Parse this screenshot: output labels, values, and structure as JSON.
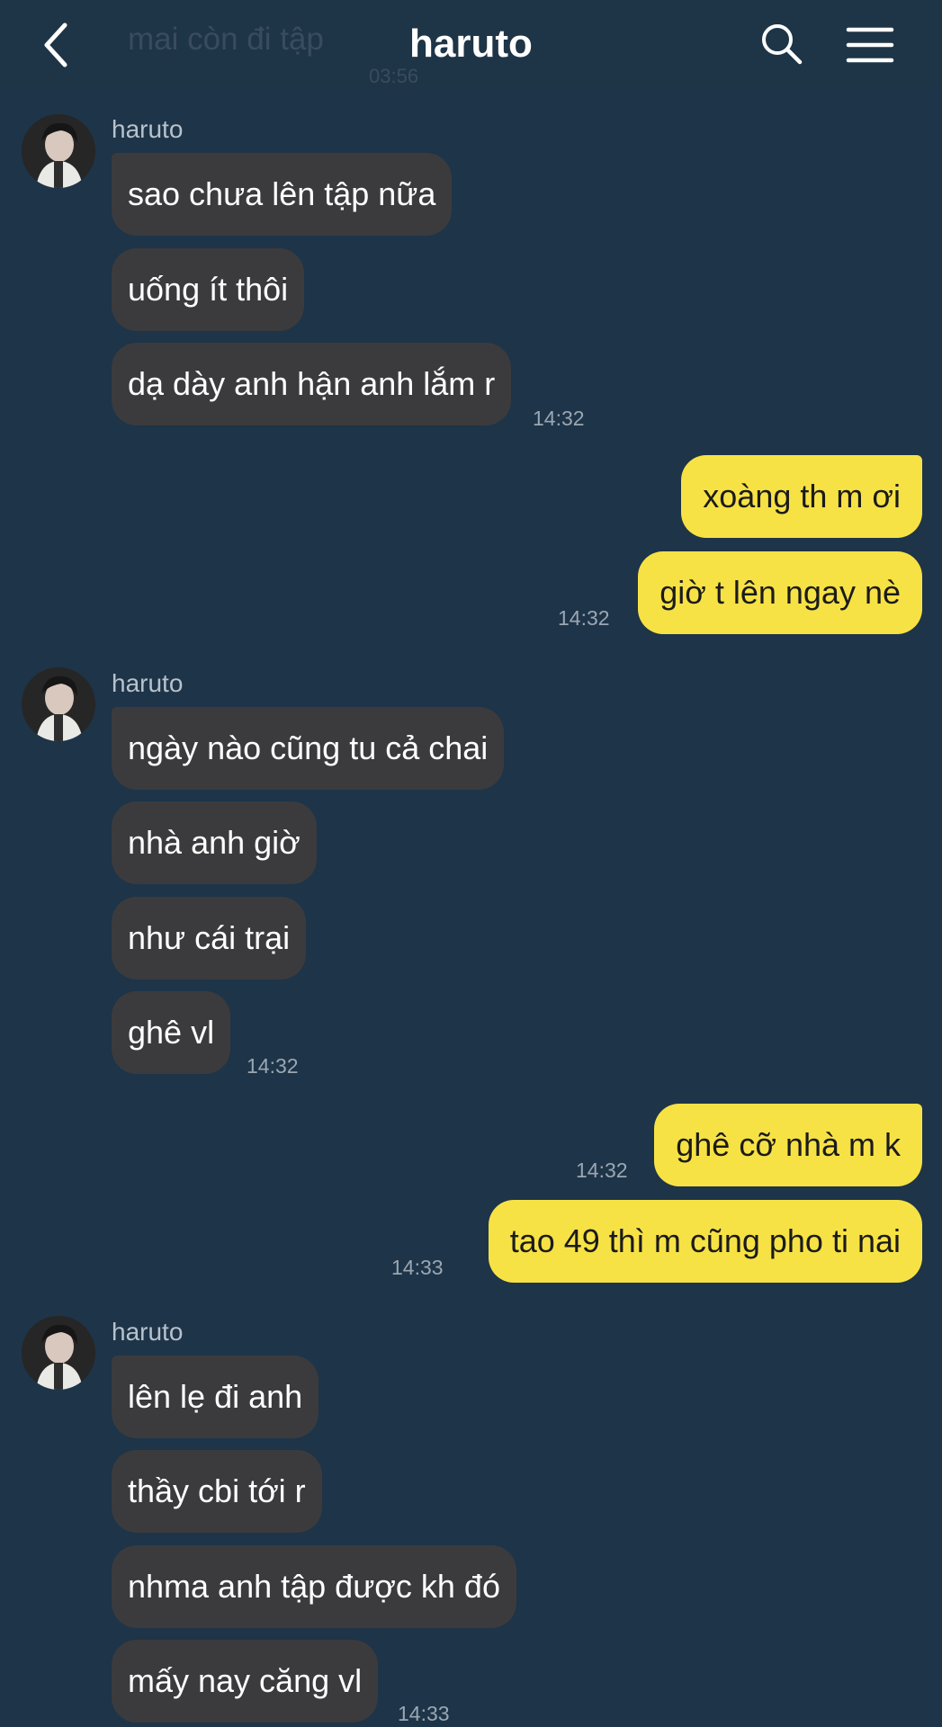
{
  "header": {
    "title": "haruto",
    "ghost_text": "mai còn đi tập",
    "ghost_time": "03:56"
  },
  "groups": [
    {
      "sender": "haruto",
      "messages": [
        "sao chưa lên tập nữa",
        "uống ít thôi",
        "dạ dày anh hận anh lắm r"
      ],
      "time": "14:32"
    },
    {
      "sender": "haruto",
      "messages": [
        "ngày nào cũng tu cả chai",
        "nhà anh giờ",
        "như cái trại",
        "ghê vl"
      ],
      "time": "14:32"
    },
    {
      "sender": "haruto",
      "messages": [
        "lên lẹ đi anh",
        "thầy cbi tới r",
        "nhma anh tập được kh đó",
        "mấy nay căng vl"
      ],
      "time": "14:33"
    }
  ],
  "outgoing": [
    {
      "text": "xoàng th m ơi",
      "time": ""
    },
    {
      "text": "giờ t lên ngay nè",
      "time": "14:32"
    },
    {
      "text": "ghê cỡ nhà m k",
      "time": "14:32"
    },
    {
      "text": "tao 49 thì m cũng pho ti nai",
      "time": "14:33"
    }
  ],
  "colors": {
    "background": "#1e3448",
    "incoming_bubble": "#3b3b3d",
    "outgoing_bubble": "#f7e245"
  }
}
